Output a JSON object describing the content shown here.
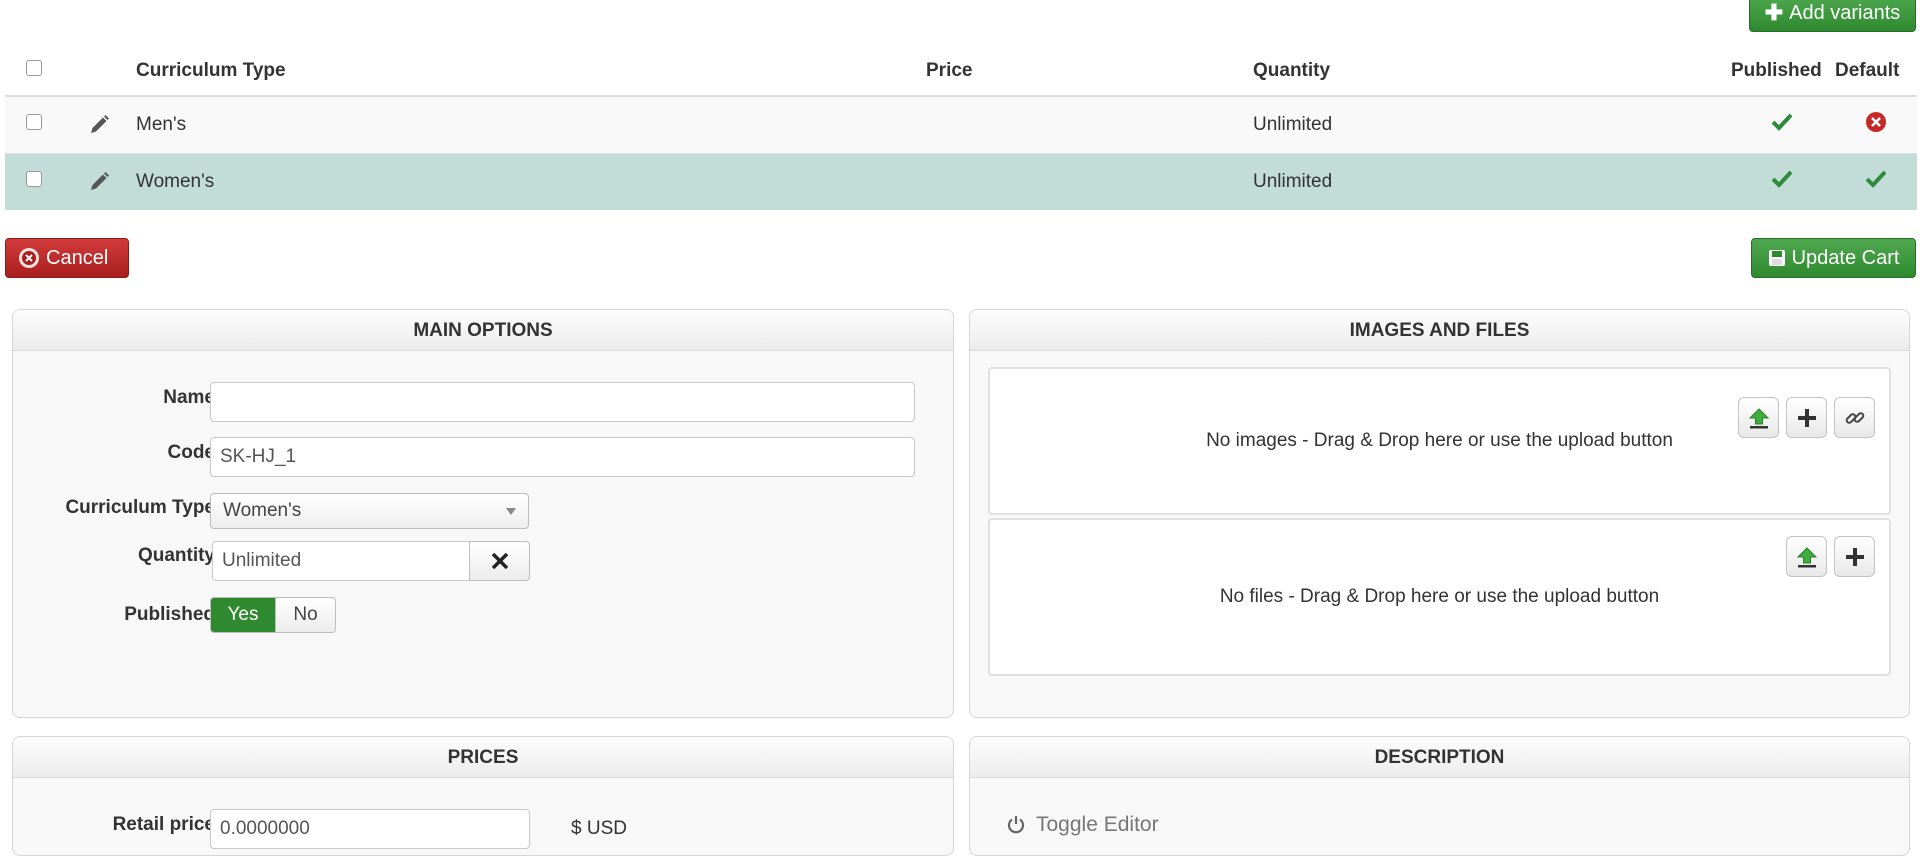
{
  "top": {
    "add_variants_label": "Add variants"
  },
  "table": {
    "headers": {
      "curriculum_type": "Curriculum Type",
      "price": "Price",
      "quantity": "Quantity",
      "published": "Published",
      "default": "Default"
    },
    "rows": [
      {
        "name": "Men's",
        "price": "",
        "quantity": "Unlimited",
        "published": true,
        "default": false
      },
      {
        "name": "Women's",
        "price": "",
        "quantity": "Unlimited",
        "published": true,
        "default": true
      }
    ]
  },
  "actions": {
    "cancel_label": "Cancel",
    "update_cart_label": "Update Cart"
  },
  "main_options": {
    "title": "MAIN OPTIONS",
    "name_label": "Name",
    "name_value": "",
    "code_label": "Code",
    "code_value": "SK-HJ_1",
    "curriculum_type_label": "Curriculum Type",
    "curriculum_type_value": "Women's",
    "quantity_label": "Quantity",
    "quantity_value": "Unlimited",
    "published_label": "Published",
    "published_yes": "Yes",
    "published_no": "No",
    "published_selected": "Yes"
  },
  "images_files": {
    "title": "IMAGES AND FILES",
    "images_empty": "No images - Drag & Drop here or use the upload button",
    "files_empty": "No files - Drag & Drop here or use the upload button"
  },
  "prices": {
    "title": "PRICES",
    "retail_price_label": "Retail price",
    "retail_price_value": "0.0000000",
    "currency": "$ USD"
  },
  "description": {
    "title": "DESCRIPTION",
    "toggle_editor_label": "Toggle Editor"
  },
  "colors": {
    "success": "#2f8a2f",
    "danger": "#b52525",
    "selected_row": "#c2dcd8",
    "check": "#2e8b3a",
    "cross": "#c62828"
  }
}
